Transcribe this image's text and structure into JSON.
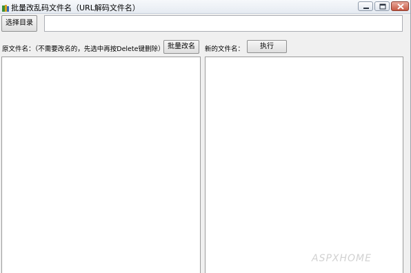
{
  "window": {
    "title": "批量改乱码文件名（URL解码文件名）"
  },
  "toolbar": {
    "select_dir_label": "选择目录",
    "path_value": "",
    "path_placeholder": ""
  },
  "labels": {
    "original_label": "原文件名：（不需要改名的，先选中再按Delete键删除）",
    "new_label": "新的文件名："
  },
  "actions": {
    "batch_rename_label": "批量改名",
    "execute_label": "执行"
  },
  "lists": {
    "original_items": [],
    "new_items": []
  },
  "watermark": "ASPXHOME",
  "icons": {
    "app": "app-icon",
    "minimize": "minimize-icon",
    "maximize": "maximize-icon",
    "close": "close-icon"
  },
  "colors": {
    "close_button": "#c75a44",
    "window_bg": "#f0f0f0"
  }
}
